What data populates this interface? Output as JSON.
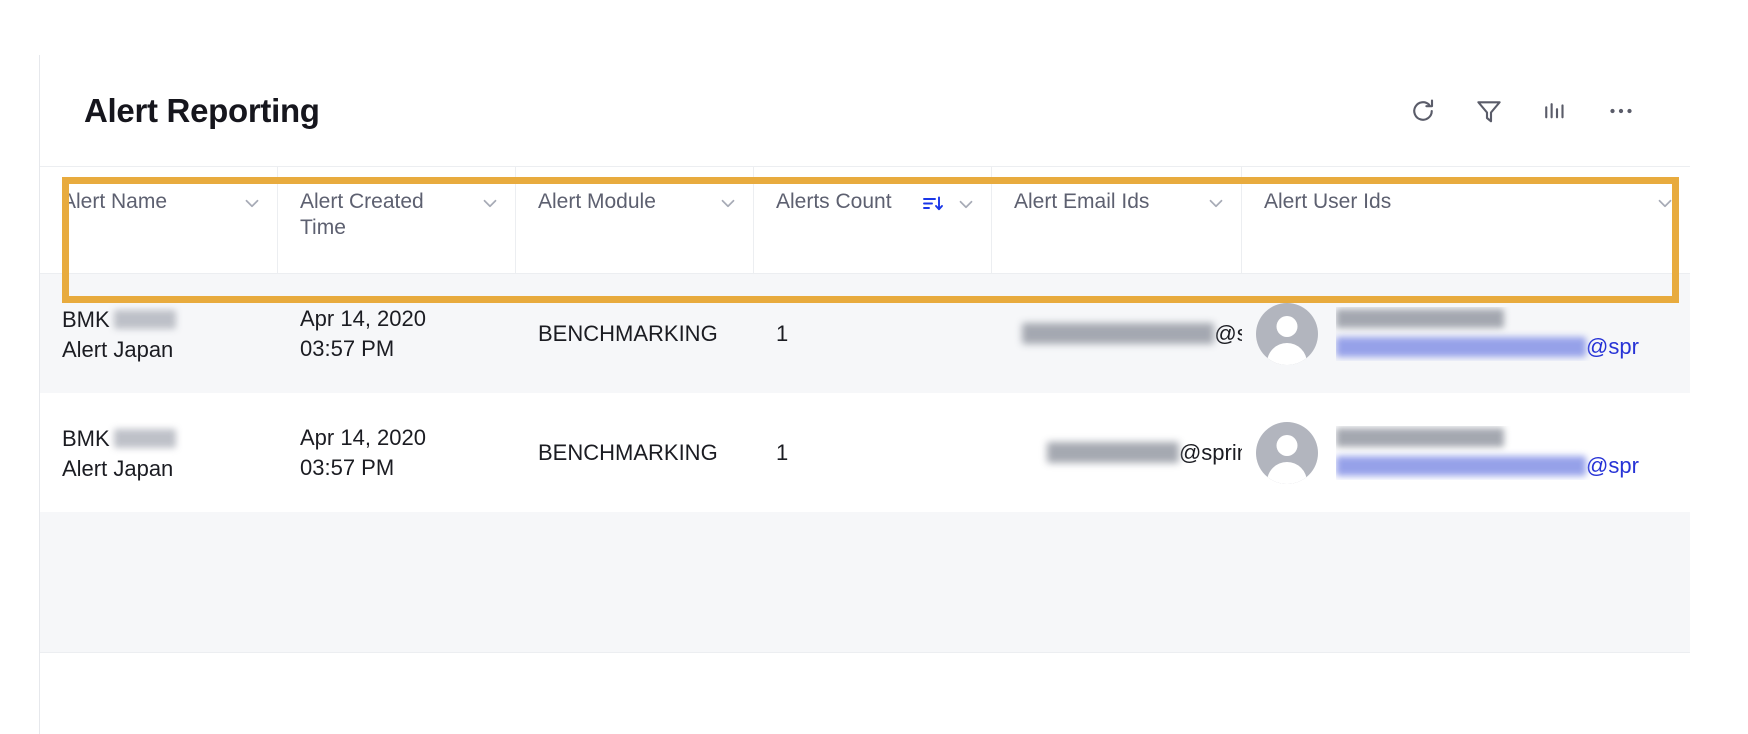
{
  "header": {
    "title": "Alert Reporting",
    "toolbar": [
      {
        "name": "refresh-icon",
        "label": "Refresh"
      },
      {
        "name": "filter-icon",
        "label": "Filter"
      },
      {
        "name": "bar-chart-icon",
        "label": "Chart View"
      },
      {
        "name": "more-options-icon",
        "label": "More options"
      }
    ]
  },
  "table": {
    "columns": [
      {
        "label": "Alert Name",
        "sorted": false,
        "has_menu": true
      },
      {
        "label": "Alert Created Time",
        "sorted": false,
        "has_menu": true
      },
      {
        "label": "Alert Module",
        "sorted": false,
        "has_menu": true
      },
      {
        "label": "Alerts Count",
        "sorted": true,
        "sort_direction": "desc",
        "has_menu": true
      },
      {
        "label": "Alert Email Ids",
        "sorted": false,
        "has_menu": true
      },
      {
        "label": "Alert User Ids",
        "sorted": false,
        "has_menu": true
      }
    ],
    "rows": [
      {
        "alert_name_prefix": "BMK",
        "alert_name_redacted": true,
        "alert_name_suffix": "Alert Japan",
        "created_date": "Apr 14, 2020",
        "created_time": "03:57 PM",
        "module": "BENCHMARKING",
        "alerts_count": "1",
        "email_redacted": true,
        "email_visible_suffix": "@sp",
        "user_name_redacted": true,
        "user_email_redacted": true,
        "user_email_visible_suffix": "@spr"
      },
      {
        "alert_name_prefix": "BMK",
        "alert_name_redacted": true,
        "alert_name_suffix": "Alert Japan",
        "created_date": "Apr 14, 2020",
        "created_time": "03:57 PM",
        "module": "BENCHMARKING",
        "alerts_count": "1",
        "email_redacted": true,
        "email_visible_suffix": "@sprink",
        "user_name_redacted": true,
        "user_email_redacted": true,
        "user_email_visible_suffix": "@spr"
      }
    ]
  },
  "annotation": {
    "highlight_color": "#e8ab3e",
    "target": "table-header-row"
  },
  "colors": {
    "accent_link": "#2733d6",
    "sort_active": "#1a37e8",
    "row_alt_bg": "#f6f7f9",
    "border": "#eceef1",
    "header_text": "#5d6070"
  }
}
